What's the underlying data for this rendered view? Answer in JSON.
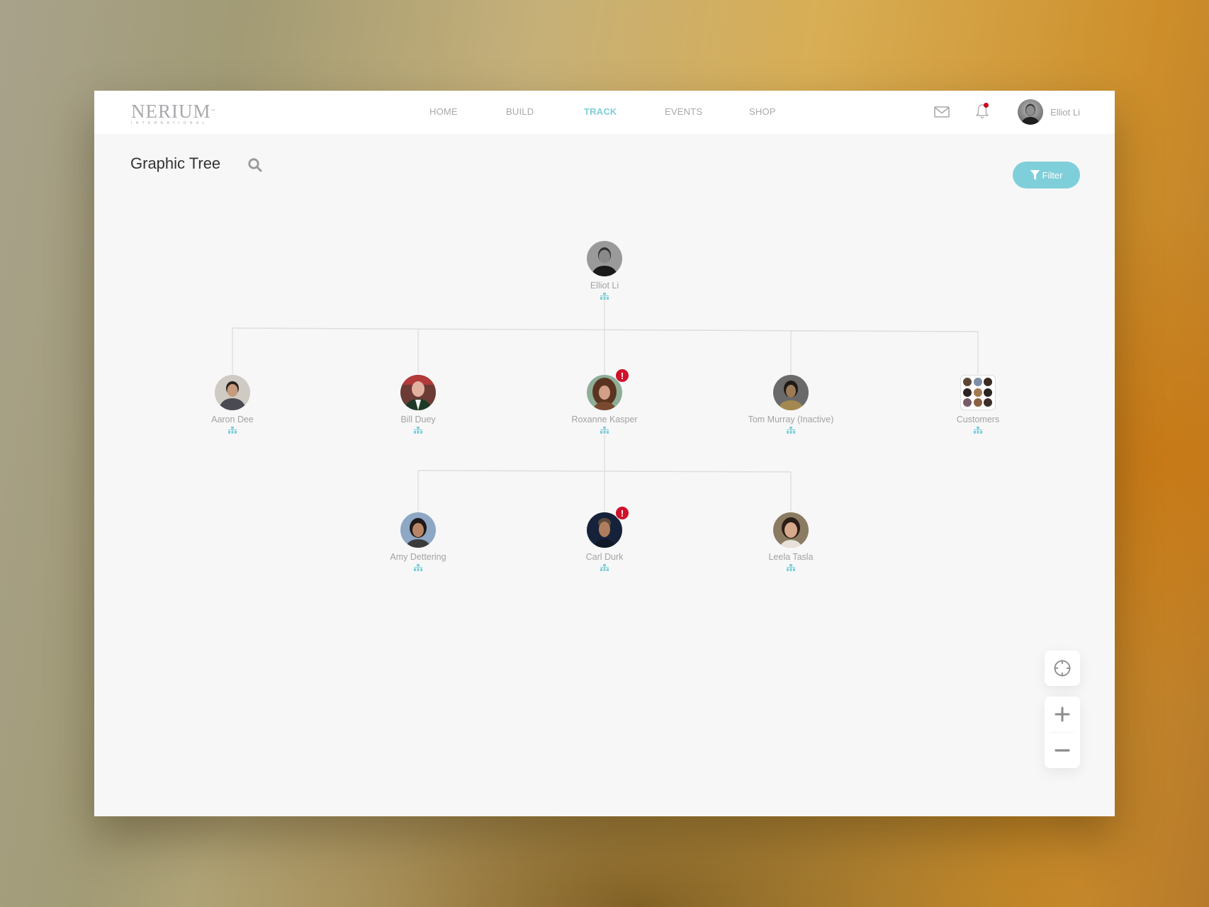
{
  "brand": {
    "name": "NERIUM",
    "subtitle": "INTERNATIONAL",
    "tm": "™"
  },
  "nav": {
    "items": [
      {
        "label": "HOME",
        "active": false
      },
      {
        "label": "BUILD",
        "active": false
      },
      {
        "label": "TRACK",
        "active": true
      },
      {
        "label": "EVENTS",
        "active": false
      },
      {
        "label": "SHOP",
        "active": false
      }
    ]
  },
  "header_icons": {
    "mail": "mail-icon",
    "notifications": "bell-icon",
    "notification_unread": true
  },
  "user": {
    "name": "Elliot Li"
  },
  "page": {
    "title": "Graphic Tree",
    "search_icon": "search-icon"
  },
  "filter": {
    "label": "Filter",
    "icon": "filter-icon"
  },
  "colors": {
    "accent": "#7fcfda",
    "alert": "#d0112b",
    "connector": "#d6d6d6"
  },
  "tree": {
    "root": {
      "name": "Elliot Li",
      "alert": false
    },
    "level1": [
      {
        "name": "Aaron Dee",
        "alert": false
      },
      {
        "name": "Bill Duey",
        "alert": false
      },
      {
        "name": "Roxanne Kasper",
        "alert": true
      },
      {
        "name": "Tom Murray (Inactive)",
        "alert": false
      },
      {
        "name": "Customers",
        "alert": false,
        "group": true
      }
    ],
    "level2_parent": "Roxanne Kasper",
    "level2": [
      {
        "name": "Amy Dettering",
        "alert": false
      },
      {
        "name": "Carl Durk",
        "alert": true
      },
      {
        "name": "Leela Tasla",
        "alert": false
      }
    ],
    "alert_symbol": "!"
  },
  "map_controls": {
    "recenter": "crosshair-icon",
    "zoom_in": "plus-icon",
    "zoom_out": "minus-icon"
  }
}
